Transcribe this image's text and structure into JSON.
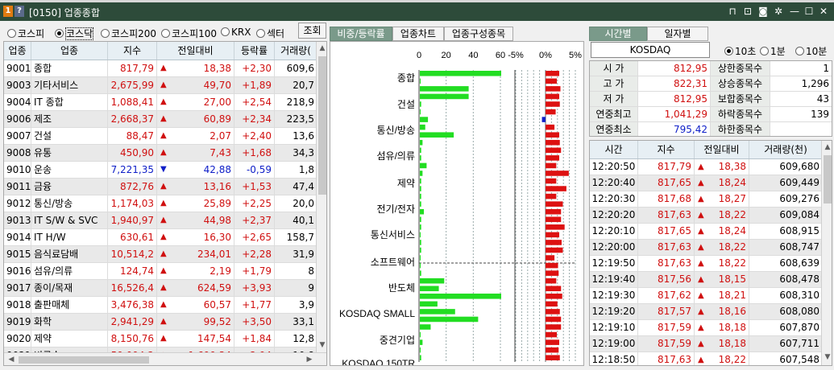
{
  "window": {
    "title": "[0150] 업종종합",
    "badge1": "1",
    "badge2": "?",
    "icons": [
      "pin-icon",
      "export-icon",
      "camera-icon",
      "settings-icon",
      "minimize-icon",
      "maximize-icon",
      "close-icon"
    ]
  },
  "left": {
    "markets": [
      {
        "label": "코스피",
        "selected": false
      },
      {
        "label": "코스닥",
        "selected": true
      },
      {
        "label": "코스피200",
        "selected": false
      },
      {
        "label": "코스피100",
        "selected": false
      },
      {
        "label": "KRX",
        "selected": false
      },
      {
        "label": "섹터",
        "selected": false
      }
    ],
    "query_button": "조회",
    "columns": [
      "업종",
      "업종",
      "지수",
      "전일대비",
      "등락률",
      "거래량("
    ],
    "rows": [
      {
        "code": "9001",
        "name": "종합",
        "index": "817,79",
        "dir": "up",
        "change": "18,38",
        "rate": "+2,30",
        "volume": "609,6"
      },
      {
        "code": "9003",
        "name": "기타서비스",
        "index": "2,675,99",
        "dir": "up",
        "change": "49,70",
        "rate": "+1,89",
        "volume": "20,7"
      },
      {
        "code": "9004",
        "name": "IT 종합",
        "index": "1,088,41",
        "dir": "up",
        "change": "27,00",
        "rate": "+2,54",
        "volume": "218,9"
      },
      {
        "code": "9006",
        "name": "제조",
        "index": "2,668,37",
        "dir": "up",
        "change": "60,89",
        "rate": "+2,34",
        "volume": "223,5"
      },
      {
        "code": "9007",
        "name": "건설",
        "index": "88,47",
        "dir": "up",
        "change": "2,07",
        "rate": "+2,40",
        "volume": "13,6"
      },
      {
        "code": "9008",
        "name": "유통",
        "index": "450,90",
        "dir": "up",
        "change": "7,43",
        "rate": "+1,68",
        "volume": "34,3"
      },
      {
        "code": "9010",
        "name": "운송",
        "index": "7,221,35",
        "dir": "down",
        "change": "42,88",
        "rate": "-0,59",
        "volume": "1,8"
      },
      {
        "code": "9011",
        "name": "금융",
        "index": "872,76",
        "dir": "up",
        "change": "13,16",
        "rate": "+1,53",
        "volume": "47,4"
      },
      {
        "code": "9012",
        "name": "통신/방송",
        "index": "1,174,03",
        "dir": "up",
        "change": "25,89",
        "rate": "+2,25",
        "volume": "20,0"
      },
      {
        "code": "9013",
        "name": "IT S/W & SVC",
        "index": "1,940,97",
        "dir": "up",
        "change": "44,98",
        "rate": "+2,37",
        "volume": "40,1"
      },
      {
        "code": "9014",
        "name": "IT H/W",
        "index": "630,61",
        "dir": "up",
        "change": "16,30",
        "rate": "+2,65",
        "volume": "158,7"
      },
      {
        "code": "9015",
        "name": "음식료담배",
        "index": "10,514,2",
        "dir": "up",
        "change": "234,01",
        "rate": "+2,28",
        "volume": "31,9"
      },
      {
        "code": "9016",
        "name": "섬유/의류",
        "index": "124,74",
        "dir": "up",
        "change": "2,19",
        "rate": "+1,79",
        "volume": "8"
      },
      {
        "code": "9017",
        "name": "종이/목재",
        "index": "16,526,4",
        "dir": "up",
        "change": "624,59",
        "rate": "+3,93",
        "volume": "9"
      },
      {
        "code": "9018",
        "name": "출판매체",
        "index": "3,476,38",
        "dir": "up",
        "change": "60,57",
        "rate": "+1,77",
        "volume": "3,9"
      },
      {
        "code": "9019",
        "name": "화학",
        "index": "2,941,29",
        "dir": "up",
        "change": "99,52",
        "rate": "+3,50",
        "volume": "33,1"
      },
      {
        "code": "9020",
        "name": "제약",
        "index": "8,150,76",
        "dir": "up",
        "change": "147,54",
        "rate": "+1,84",
        "volume": "12,8"
      },
      {
        "code": "9021",
        "name": "비금속",
        "index": "59,094,2",
        "dir": "up",
        "change": "1,690,34",
        "rate": "+2,94",
        "volume": "10,8"
      },
      {
        "code": "9022",
        "name": "금속",
        "index": "2,026,16",
        "dir": "up",
        "change": "51,00",
        "rate": "+2,58",
        "volume": "11,8"
      }
    ]
  },
  "middle": {
    "tabs": [
      "비중/등락률",
      "업종차트",
      "업종구성종목"
    ],
    "active_tab": 0,
    "chart_data": {
      "type": "bar",
      "weight_axis_ticks": [
        "0",
        "20",
        "40",
        "60"
      ],
      "weight_xlim": [
        0,
        60
      ],
      "rate_axis_ticks": [
        "-5%",
        "0%",
        "5%"
      ],
      "rate_xlim": [
        -5,
        5
      ],
      "labels": [
        "종합",
        "건설",
        "통신/방송",
        "섬유/의류",
        "제약",
        "전기/전자",
        "통신서비스",
        "소프트웨어",
        "반도체",
        "KOSDAQ SMALL",
        "중견기업",
        "KOSDAQ 150TR"
      ],
      "weights": [
        60,
        0.5,
        36,
        36,
        1,
        0.5,
        6,
        4,
        25,
        2,
        1,
        1,
        5,
        2,
        1,
        1,
        1,
        1,
        3,
        1,
        1,
        0.5,
        1,
        1,
        0.5,
        0.5,
        1,
        18,
        14,
        60,
        13,
        26,
        43,
        8,
        0.5,
        2,
        0.5,
        1
      ],
      "rates": [
        2.3,
        1.9,
        2.5,
        2.3,
        2.4,
        1.7,
        -0.6,
        1.5,
        2.3,
        2.4,
        2.6,
        2.3,
        1.8,
        3.9,
        1.8,
        3.5,
        1.8,
        2.9,
        2.6,
        2.6,
        3.2,
        2.3,
        2.7,
        2.9,
        1.5,
        2.1,
        2.2,
        1.8,
        2.6,
        2.8,
        2.0,
        2.4,
        2.6,
        2.6,
        1.9,
        2.3,
        2.2,
        2.4
      ]
    }
  },
  "right": {
    "tabs": [
      "시간별",
      "일자별"
    ],
    "active_tab": 0,
    "market_name": "KOSDAQ",
    "intervals": [
      {
        "label": "10초",
        "selected": true
      },
      {
        "label": "1분",
        "selected": false
      },
      {
        "label": "10분",
        "selected": false
      }
    ],
    "summary": [
      {
        "label": "시  가",
        "value": "812,95",
        "label2": "상한종목수",
        "value2": "1"
      },
      {
        "label": "고  가",
        "value": "822,31",
        "label2": "상승종목수",
        "value2": "1,296"
      },
      {
        "label": "저  가",
        "value": "812,95",
        "label2": "보합종목수",
        "value2": "43"
      },
      {
        "label": "연중최고",
        "value": "1,041,29",
        "label2": "하락종목수",
        "value2": "139"
      },
      {
        "label": "연중최소",
        "value": "795,42",
        "label2": "하한종목수",
        "value2": ""
      }
    ],
    "columns": [
      "시간",
      "지수",
      "전일대비",
      "거래량(천)"
    ],
    "rows": [
      {
        "time": "12:20:50",
        "index": "817,79",
        "change": "18,38",
        "volume": "609,680"
      },
      {
        "time": "12:20:40",
        "index": "817,65",
        "change": "18,24",
        "volume": "609,449"
      },
      {
        "time": "12:20:30",
        "index": "817,68",
        "change": "18,27",
        "volume": "609,276"
      },
      {
        "time": "12:20:20",
        "index": "817,63",
        "change": "18,22",
        "volume": "609,084"
      },
      {
        "time": "12:20:10",
        "index": "817,65",
        "change": "18,24",
        "volume": "608,915"
      },
      {
        "time": "12:20:00",
        "index": "817,63",
        "change": "18,22",
        "volume": "608,747"
      },
      {
        "time": "12:19:50",
        "index": "817,63",
        "change": "18,22",
        "volume": "608,639"
      },
      {
        "time": "12:19:40",
        "index": "817,56",
        "change": "18,15",
        "volume": "608,478"
      },
      {
        "time": "12:19:30",
        "index": "817,62",
        "change": "18,21",
        "volume": "608,310"
      },
      {
        "time": "12:19:20",
        "index": "817,57",
        "change": "18,16",
        "volume": "608,080"
      },
      {
        "time": "12:19:10",
        "index": "817,59",
        "change": "18,18",
        "volume": "607,870"
      },
      {
        "time": "12:19:00",
        "index": "817,59",
        "change": "18,18",
        "volume": "607,711"
      },
      {
        "time": "12:18:50",
        "index": "817,63",
        "change": "18,22",
        "volume": "607,548"
      }
    ]
  },
  "colors": {
    "titlebar": "#2d4b3a",
    "up": "#d01010",
    "down": "#1020c8",
    "weight_bar": "#22dd22",
    "rate_bar": "#dd1111",
    "tab_active": "#7a9a8a"
  }
}
